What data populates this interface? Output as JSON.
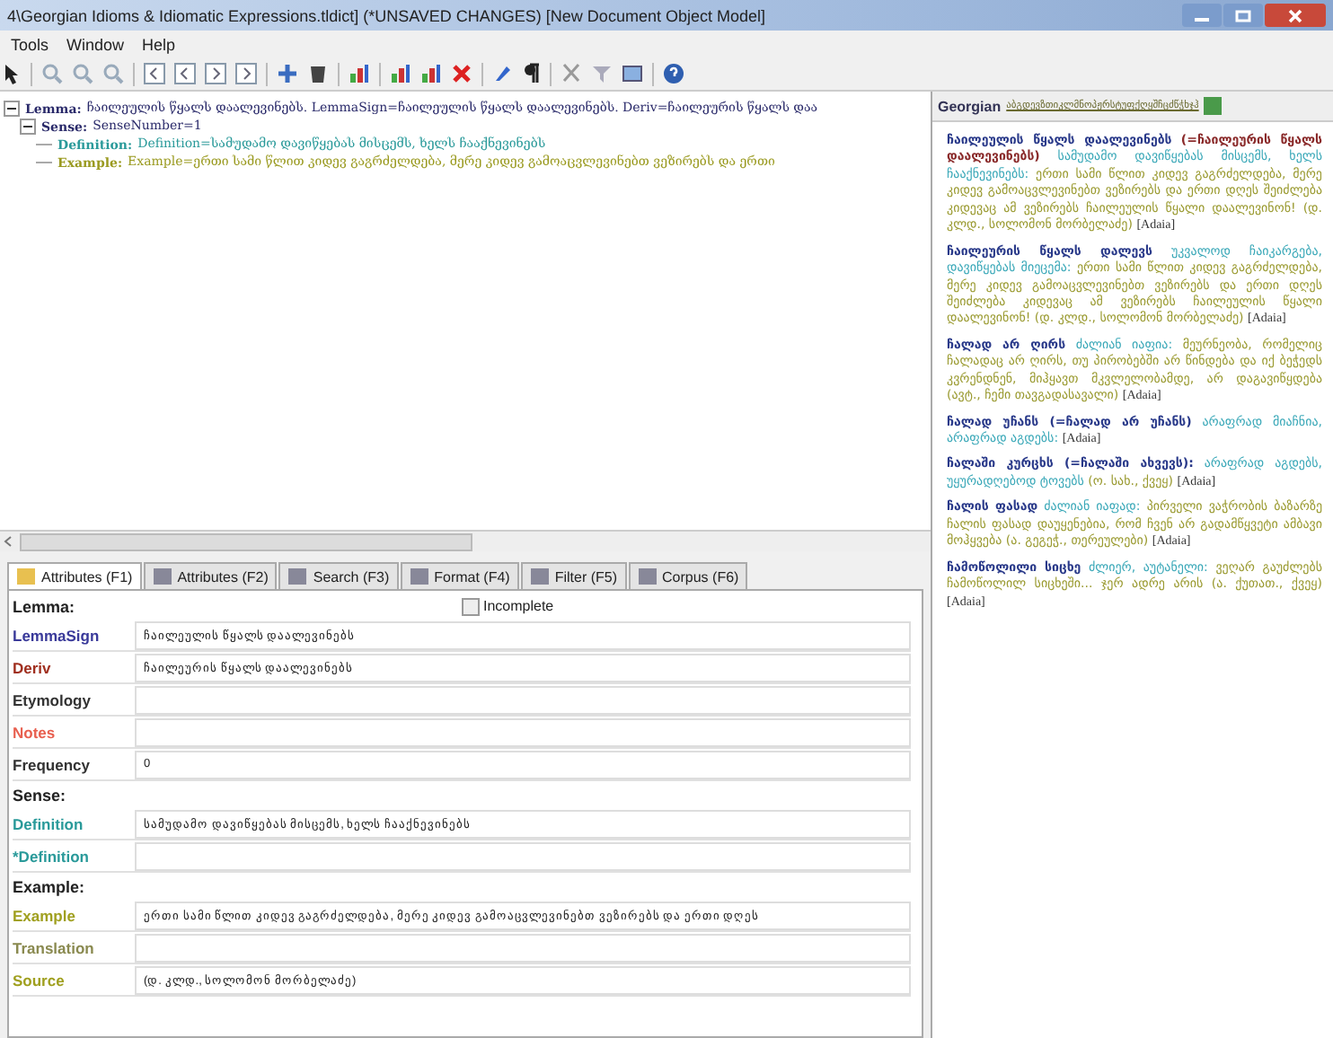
{
  "window": {
    "title": "4\\Georgian Idioms & Idiomatic Expressions.tldict] (*UNSAVED CHANGES) [New Document Object Model]"
  },
  "menu": [
    "Tools",
    "Window",
    "Help"
  ],
  "tree": [
    {
      "label": "Lemma:",
      "text": "ჩაილეულის წყალს დაალევინებს. LemmaSign=ჩაილეულის წყალს დაალევინებს. Deriv=ჩაილეურის წყალს დაა",
      "color": "#2a2a6a",
      "expanded": true,
      "children": [
        {
          "label": "Sense:",
          "text": "SenseNumber=1",
          "color": "#2a2a6a",
          "expanded": true,
          "children": [
            {
              "label": "Definition:",
              "text": "Definition=სამუდამო დავიწყებას მისცემს, ხელს ჩააქნევინებს",
              "color": "#2a9a9a"
            },
            {
              "label": "Example:",
              "text": "Example=ერთი სამი წლით კიდევ გაგრძელდება, მერე კიდევ გამოაცვლევინებთ ვეზირებს და ერთი",
              "color": "#9a9a20"
            }
          ]
        }
      ]
    }
  ],
  "reference": {
    "language": "Georgian",
    "alphabet": "აბგდევზთიკლმნოპჟრსტუფქღყშჩცძწჭხჯჰ",
    "entries": [
      {
        "headword": "ჩაილეულის წყალს დაალევინებს",
        "deriv": "(=ჩაილეურის წყალს დაალევინებს)",
        "definition": "სამუდამო დავიწყებას მისცემს, ხელს ჩააქნევინებს:",
        "example": "ერთი სამი წლით კიდევ გაგრძელდება, მერე კიდევ გამოაცვლევინებთ ვეზირებს და ერთი დღეს შეიძლება კიდევაც ამ ვეზირებს ჩაილეულის წყალი დაალევინონ!",
        "source": "(დ. კლდ., სოლომონ მორბელაძე)",
        "ref": "[Adaia]"
      },
      {
        "headword": "ჩაილეურის წყალს დალევს",
        "definition": "უკვალოდ ჩაიკარგება, დავიწყებას მიეცემა:",
        "example": "ერთი სამი წლით კიდევ გაგრძელდება, მერე კიდევ გამოაცვლევინებთ ვეზირებს და ერთი დღეს შეიძლება კიდევაც ამ ვეზირებს ჩაილეულის წყალი დაალევინონ!",
        "source": "(დ. კლდ., სოლომონ მორბელაძე)",
        "ref": "[Adaia]"
      },
      {
        "headword": "ჩალად არ ღირს",
        "definition": "ძალიან იაფია:",
        "example": "მეურნეობა, რომელიც ჩალადაც არ ღირს, თუ პირობებში არ წინდება და იქ ბეჭედს კვრენდნენ, მიჰყავთ მკვლელობამდე, არ დაგავიწყდება",
        "source": "(ავტ., ჩემი თავგადასავალი)",
        "ref": "[Adaia]"
      },
      {
        "headword": "ჩალად უჩანს (=ჩალად არ უჩანს)",
        "definition": "არაფრად მიაჩნია, არაფრად აგდებს:",
        "ref": "[Adaia]"
      },
      {
        "headword": "ჩალაში კურცხს (=ჩალაში ახვევს):",
        "definition": "არაფრად აგდებს, უყურადღებოდ ტოვებს",
        "source": "(ო. სახ., ქვეყ)",
        "ref": "[Adaia]"
      },
      {
        "headword": "ჩალის ფასად",
        "definition": "ძალიან იაფად:",
        "example": "პირველი ვაჭრობის ბაზარზე ჩალის ფასად დაუყენებია, რომ ჩვენ არ გადამწყვეტი ამბავი მოჰყვება",
        "source": "(ა. გეგეჭ., თერეულები)",
        "ref": "[Adaia]"
      },
      {
        "headword": "ჩამოწოლილი სიცხე",
        "definition": "ძლიერ, აუტანელი:",
        "example": "ვეღარ გაუძლებს ჩამოწოლილ სიცხეში... ჯერ ადრე არის",
        "source": "(ა. ქუთათ., ქვეყ)",
        "ref": "[Adaia]"
      }
    ]
  },
  "tabs": [
    {
      "label": "Attributes (F1)",
      "selected": true
    },
    {
      "label": "Attributes (F2)",
      "selected": false
    },
    {
      "label": "Search (F3)",
      "selected": false
    },
    {
      "label": "Format (F4)",
      "selected": false
    },
    {
      "label": "Filter (F5)",
      "selected": false
    },
    {
      "label": "Corpus (F6)",
      "selected": false
    }
  ],
  "attributes": [
    {
      "kind": "section",
      "label": "Lemma:",
      "checkbox": {
        "label": "Incomplete",
        "checked": false
      }
    },
    {
      "kind": "field",
      "label": "LemmaSign",
      "color": "#3a3a9a",
      "value": "ჩაილეულის წყალს დაალევინებს"
    },
    {
      "kind": "field",
      "label": "Deriv",
      "color": "#a03020",
      "value": "ჩაილეურის წყალს დაალევინებს"
    },
    {
      "kind": "field",
      "label": "Etymology",
      "color": "#333333"
    },
    {
      "kind": "field",
      "label": "Notes",
      "color": "#e86050"
    },
    {
      "kind": "field",
      "label": "Frequency",
      "color": "#333333",
      "value": "0"
    },
    {
      "kind": "section",
      "label": "Sense:"
    },
    {
      "kind": "field",
      "label": "Definition",
      "color": "#2a9a9a",
      "value": "სამუდამო დავიწყებას მისცემს, ხელს ჩააქნევინებს"
    },
    {
      "kind": "field",
      "label": "*Definition",
      "color": "#2a9a9a"
    },
    {
      "kind": "section",
      "label": "Example:"
    },
    {
      "kind": "field",
      "label": "Example",
      "color": "#a0a020",
      "value": "ერთი სამი წლით კიდევ გაგრძელდება, მერე კიდევ გამოაცვლევინებთ ვეზირებს და ერთი დღეს"
    },
    {
      "kind": "field",
      "label": "Translation",
      "color": "#8a8a50"
    },
    {
      "kind": "field",
      "label": "Source",
      "color": "#a0a020",
      "value": "(დ. კლდ., სოლომონ მორბელაძე)"
    }
  ]
}
